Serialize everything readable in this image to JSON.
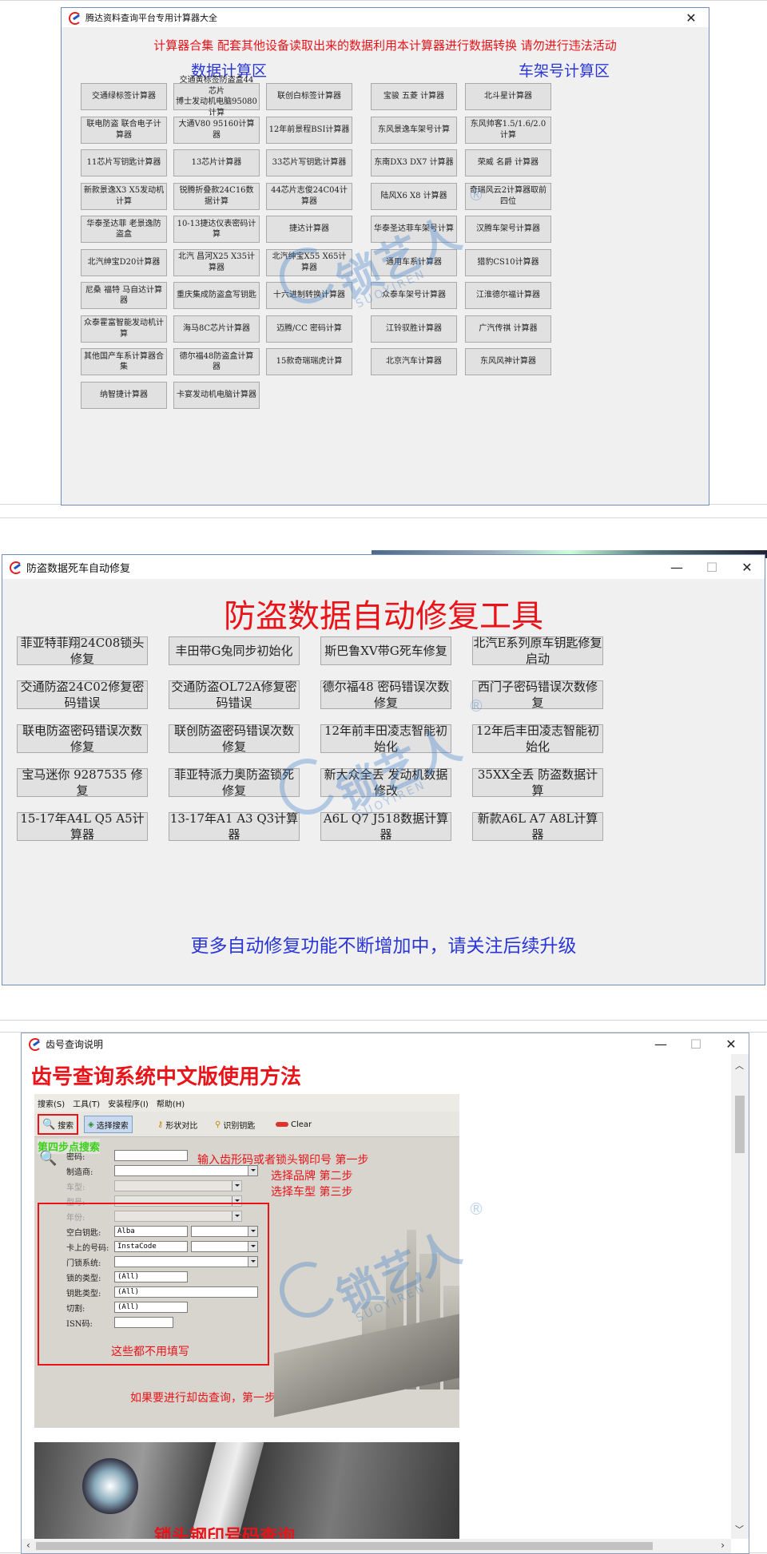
{
  "s1": {
    "title": "腾达资料查询平台专用计算器大全",
    "notice": "计算器合集  配套其他设备读取出来的数据利用本计算器进行数据转换  请勿进行违法活动",
    "left_heading": "数据计算区",
    "right_heading": "车架号计算区",
    "left_buttons": [
      [
        "交通绿标签计算器",
        "交通黄标签防盗盒44芯片\n博士发动机电脑95080计算",
        "联创白标签计算器"
      ],
      [
        "联电防盗 联合电子计算器",
        "大通V80 95160计算器",
        "12年前景程BSI计算器"
      ],
      [
        "11芯片写钥匙计算器",
        "13芯片计算器",
        "33芯片写钥匙计算器"
      ],
      [
        "新款景逸X3 X5发动机计算",
        "锐腾折叠款24C16数据计算",
        "44芯片志俊24C04计算器"
      ],
      [
        "华泰圣达菲 老景逸防盗盒",
        "10-13捷达仪表密码计算",
        "捷达计算器"
      ],
      [
        "北汽绅宝D20计算器",
        "北汽 昌河X25 X35计算器",
        "北汽绅宝X55 X65计算器"
      ],
      [
        "尼桑 福特 马自达计算器",
        "重庆集成防盗盒写钥匙",
        "十六进制转换计算器"
      ],
      [
        "众泰霍富智能发动机计算",
        "海马8C芯片计算器",
        "迈腾/CC 密码计算"
      ],
      [
        "其他国产车系计算器合集",
        "德尔福48防盗盒计算器",
        "15款奇瑞瑞虎计算"
      ],
      [
        "纳智捷计算器",
        "卡宴发动机电脑计算器"
      ]
    ],
    "right_buttons": [
      [
        "宝骏 五菱 计算器",
        "北斗星计算器"
      ],
      [
        "东风景逸车架号计算",
        "东风帅客1.5/1.6/2.0计算"
      ],
      [
        "东南DX3 DX7 计算器",
        "荣威 名爵 计算器"
      ],
      [
        "陆风X6 X8 计算器",
        "奇瑞风云2计算器取前四位"
      ],
      [
        "华泰圣达菲车架号计算",
        "汉腾车架号计算器"
      ],
      [
        "通用车系计算器",
        "猎豹CS10计算器"
      ],
      [
        "众泰车架号计算器",
        "江淮德尔福计算器"
      ],
      [
        "江铃驭胜计算器",
        "广汽传祺 计算器"
      ],
      [
        "北京汽车计算器",
        "东风风神计算器"
      ]
    ]
  },
  "s2": {
    "title": "防盗数据死车自动修复",
    "heading": "防盗数据自动修复工具",
    "buttons": [
      [
        "菲亚特菲翔24C08锁头修复",
        "丰田带G兔同步初始化",
        "斯巴鲁XV带G死车修复",
        "北汽E系列原车钥匙修复启动"
      ],
      [
        "交通防盗24C02修复密码错误",
        "交通防盗OL72A修复密码错误",
        "德尔福48 密码错误次数修复",
        "西门子密码错误次数修复"
      ],
      [
        "联电防盗密码错误次数修复",
        "联创防盗密码错误次数修复",
        "12年前丰田凌志智能初始化",
        "12年后丰田凌志智能初始化"
      ],
      [
        "宝马迷你 9287535 修复",
        "菲亚特派力奥防盗锁死修复",
        "新大众全丢 发动机数据修改",
        "35XX全丢 防盗数据计算"
      ],
      [
        "15-17年A4L Q5 A5计算器",
        "13-17年A1 A3 Q3计算器",
        "A6L Q7 J518数据计算器",
        "新款A6L A7 A8L计算器"
      ]
    ],
    "footer": "更多自动修复功能不断增加中，请关注后续升级"
  },
  "s3": {
    "title": "齿号查询说明",
    "heading": "齿号查询系统中文版使用方法",
    "menu": [
      "搜索(S)",
      "工具(T)",
      "安装程序(I)",
      "帮助(H)"
    ],
    "toolbar": [
      "搜索",
      "选择搜索",
      "形状对比",
      "识别钥匙",
      "Clear"
    ],
    "step4": "第四步点搜索",
    "labels": [
      "密码:",
      "制造商:",
      "车型:",
      "型号:",
      "年份:",
      "空白钥匙:",
      "卡上的号码:",
      "门锁系统:",
      "锁的类型:",
      "钥匙类型:",
      "切割:",
      "ISN码:"
    ],
    "values": {
      "blank_key": "Alba",
      "card_no": "InstaCode",
      "lock_type": "(All)",
      "key_type": "(All)",
      "cut": "(All)"
    },
    "ann1": "输入齿形码或者锁头钢印号 第一步",
    "ann2": "选择品牌  第二步",
    "ann3": "选择车型  第三步",
    "ann4": "这些都不用填写",
    "ann5": "如果要进行却齿查询，第一步不用填写",
    "photo_caption": "锁头钢印号码查询"
  },
  "watermark": {
    "brand": "锁艺人",
    "sub": "SUOYIREN",
    "reg": "®"
  },
  "colors": {
    "accent_red": "#e8141a",
    "accent_blue": "#2a36d6"
  }
}
